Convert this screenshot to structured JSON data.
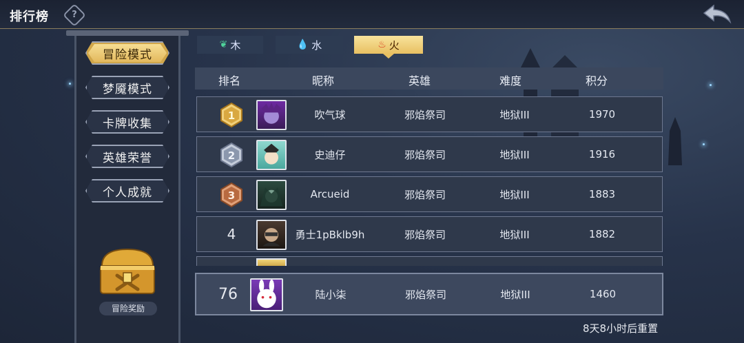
{
  "header": {
    "title": "排行榜",
    "help_icon": "question-icon",
    "back_icon": "back-arrow-icon"
  },
  "sidebar": {
    "items": [
      {
        "label": "冒险模式",
        "active": true
      },
      {
        "label": "梦魇模式",
        "active": false
      },
      {
        "label": "卡牌收集",
        "active": false
      },
      {
        "label": "英雄荣誉",
        "active": false
      },
      {
        "label": "个人成就",
        "active": false
      }
    ],
    "reward_label": "冒险奖励"
  },
  "element_tabs": [
    {
      "label": "木",
      "icon": "leaf-icon",
      "active": false
    },
    {
      "label": "水",
      "icon": "water-drop-icon",
      "active": false
    },
    {
      "label": "火",
      "icon": "flame-icon",
      "active": true
    }
  ],
  "table": {
    "headers": [
      "排名",
      "昵称",
      "英雄",
      "难度",
      "积分"
    ],
    "rows": [
      {
        "rank": "1",
        "name": "吹气球",
        "hero": "邪焰祭司",
        "difficulty": "地狱III",
        "score": "1970"
      },
      {
        "rank": "2",
        "name": "史迪仔",
        "hero": "邪焰祭司",
        "difficulty": "地狱III",
        "score": "1916"
      },
      {
        "rank": "3",
        "name": "Arcueid",
        "hero": "邪焰祭司",
        "difficulty": "地狱III",
        "score": "1883"
      },
      {
        "rank": "4",
        "name": "勇士1pBklb9h",
        "hero": "邪焰祭司",
        "difficulty": "地狱III",
        "score": "1882"
      }
    ],
    "self": {
      "rank": "76",
      "name": "陆小柒",
      "hero": "邪焰祭司",
      "difficulty": "地狱III",
      "score": "1460"
    }
  },
  "footer": {
    "reset_text": "8天8小时后重置"
  },
  "colors": {
    "gold": "#e8c062",
    "panel": "#2f394b",
    "header": "#3b475d",
    "background": "#27334a"
  }
}
